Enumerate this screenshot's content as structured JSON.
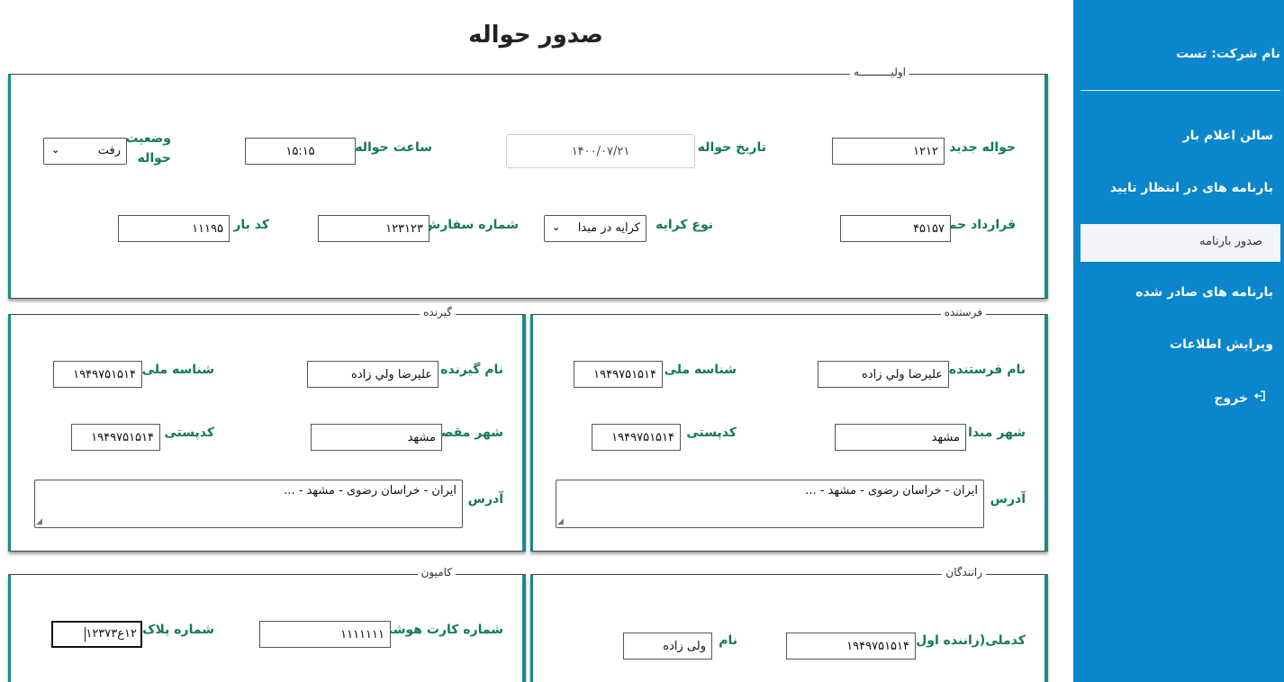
{
  "page": {
    "title": "صدور حواله"
  },
  "sidebar": {
    "company": "نام شرکت: تست",
    "items": [
      {
        "label": "سالن اعلام بار"
      },
      {
        "label": "بارنامه های در انتظار تایید"
      },
      {
        "label": "صدور بارنامه"
      },
      {
        "label": "بارنامه های صادر شده"
      },
      {
        "label": "ویرایش اطلاعات"
      },
      {
        "label": "خروج"
      }
    ],
    "active_item": "صدور بارنامه",
    "colors": {
      "background": "#0a86cc",
      "active_bg": "#f2f4f7"
    },
    "icons": {
      "logout": "logout-icon"
    }
  },
  "initial": {
    "legend": "اولیــــــــــه",
    "new_remittance_label": "حواله جدید",
    "new_remittance_value": "۱۲۱۲",
    "remittance_date_label": "تاریخ حواله",
    "remittance_date_value": "۱۴۰۰/۰۷/۲۱",
    "remittance_time_label": "ساعت حواله",
    "remittance_time_value": "۱۵:۱۵",
    "status_label": "وضعیت حواله",
    "status_value": "رفت",
    "contract_label": "قرارداد حمل",
    "contract_value": "۴۵۱۵۷",
    "fare_type_label": "نوع کرایه",
    "fare_type_value": "کرایه در مبدا",
    "order_number_label": "شماره سفارش",
    "order_number_value": "۱۲۳۱۲۳",
    "cargo_code_label": "کد بار",
    "cargo_code_value": "۱۱۱۹۵"
  },
  "sender": {
    "legend": "فرستنده",
    "name_label": "نام فرستنده",
    "name_value": "عليرضا ولي زاده",
    "national_id_label": "شناسه ملی",
    "national_id_value": "۱۹۴۹۷۵۱۵۱۴",
    "origin_city_label": "شهر مبدا",
    "origin_city_value": "مشهد",
    "postal_code_label": "کدپستی",
    "postal_code_value": "۱۹۴۹۷۵۱۵۱۴",
    "address_label": "آدرس",
    "address_value": "ایران - خراسان رضوی - مشهد - ..."
  },
  "receiver": {
    "legend": "گیرنده",
    "name_label": "نام گیرنده",
    "name_value": "عليرضا ولي زاده",
    "national_id_label": "شناسه ملی",
    "national_id_value": "۱۹۴۹۷۵۱۵۱۴",
    "dest_city_label": "شهر مقصد",
    "dest_city_value": "مشهد",
    "postal_code_label": "کدپستی",
    "postal_code_value": "۱۹۴۹۷۵۱۵۱۴",
    "address_label": "آدرس",
    "address_value": "ایران - خراسان رضوی - مشهد - ..."
  },
  "drivers": {
    "legend": "رانندگان",
    "national_code_label": "کدملی(راننده اول)",
    "national_code_value": "۱۹۴۹۷۵۱۵۱۴",
    "name_label": "نام",
    "name_value": "ولی زاده"
  },
  "truck": {
    "legend": "کامیون",
    "smart_card_label": "شماره کارت هوشمند",
    "smart_card_value": "۱۱۱۱۱۱۱",
    "plate_label": "شماره پلاک",
    "plate_value": "۱۲ع۱۲۳۷۳"
  },
  "panel_accent_color": "#1b8a88",
  "label_color": "#14795a"
}
